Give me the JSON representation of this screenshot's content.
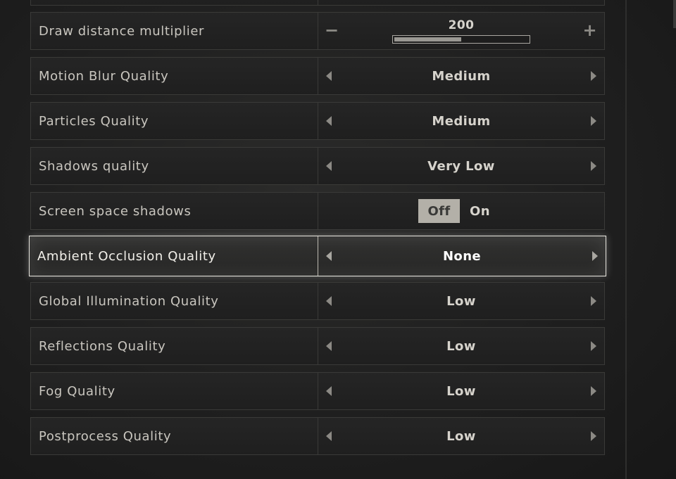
{
  "settings": {
    "draw_distance": {
      "label": "Draw distance multiplier",
      "value": "200",
      "fill_fraction": 0.5,
      "minus": "−",
      "plus": "+"
    },
    "motion_blur": {
      "label": "Motion Blur Quality",
      "value": "Medium"
    },
    "particles": {
      "label": "Particles Quality",
      "value": "Medium"
    },
    "shadows": {
      "label": "Shadows quality",
      "value": "Very Low"
    },
    "screen_space_shadows": {
      "label": "Screen space shadows",
      "off": "Off",
      "on": "On",
      "selected": "Off"
    },
    "ambient_occlusion": {
      "label": "Ambient Occlusion Quality",
      "value": "None",
      "focused": true
    },
    "global_illumination": {
      "label": "Global Illumination Quality",
      "value": "Low"
    },
    "reflections": {
      "label": "Reflections Quality",
      "value": "Low"
    },
    "fog": {
      "label": "Fog Quality",
      "value": "Low"
    },
    "postprocess": {
      "label": "Postprocess Quality",
      "value": "Low"
    }
  },
  "icons": {
    "left_arrow": "caret-left-icon",
    "right_arrow": "caret-right-icon"
  },
  "colors": {
    "text": "#c9c6bf",
    "selected_border": "#e9e7e0",
    "toggle_active_bg": "#b3b0a8"
  }
}
